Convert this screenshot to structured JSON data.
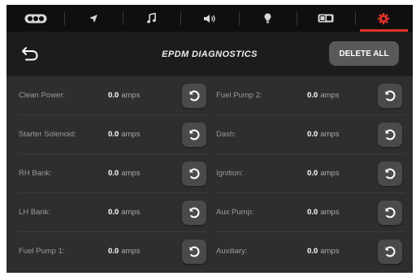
{
  "nav": {
    "tabs": [
      {
        "icon": "switch-panel-icon",
        "active": false
      },
      {
        "icon": "navigation-arrow-icon",
        "active": false
      },
      {
        "icon": "music-note-icon",
        "active": false
      },
      {
        "icon": "speaker-volume-icon",
        "active": false
      },
      {
        "icon": "light-bulb-icon",
        "active": false
      },
      {
        "icon": "toggle-switch-icon",
        "active": false
      },
      {
        "icon": "gear-icon",
        "active": true
      }
    ]
  },
  "header": {
    "title": "EPDM DIAGNOSTICS",
    "delete_all_label": "DELETE ALL",
    "back_icon": "back-arrow-icon"
  },
  "channels": {
    "left": [
      {
        "label": "Clean Power:",
        "value": "0.0",
        "unit": "amps"
      },
      {
        "label": "Starter Solenoid:",
        "value": "0.0",
        "unit": "amps"
      },
      {
        "label": "RH Bank:",
        "value": "0.0",
        "unit": "amps"
      },
      {
        "label": "LH Bank:",
        "value": "0.0",
        "unit": "amps"
      },
      {
        "label": "Fuel Pump 1:",
        "value": "0.0",
        "unit": "amps"
      }
    ],
    "right": [
      {
        "label": "Fuel Pump 2:",
        "value": "0.0",
        "unit": "amps"
      },
      {
        "label": "Dash:",
        "value": "0.0",
        "unit": "amps"
      },
      {
        "label": "Ignition:",
        "value": "0.0",
        "unit": "amps"
      },
      {
        "label": "Aux Pump:",
        "value": "0.0",
        "unit": "amps"
      },
      {
        "label": "Auxiliary:",
        "value": "0.0",
        "unit": "amps"
      }
    ],
    "reset_icon": "reset-arrow-icon"
  },
  "colors": {
    "accent": "#e2312a",
    "background": "#2e2e2f",
    "header_bg": "#1c1c1d",
    "nav_bg": "#0f0f10",
    "button_bg": "#4a4a4b"
  }
}
